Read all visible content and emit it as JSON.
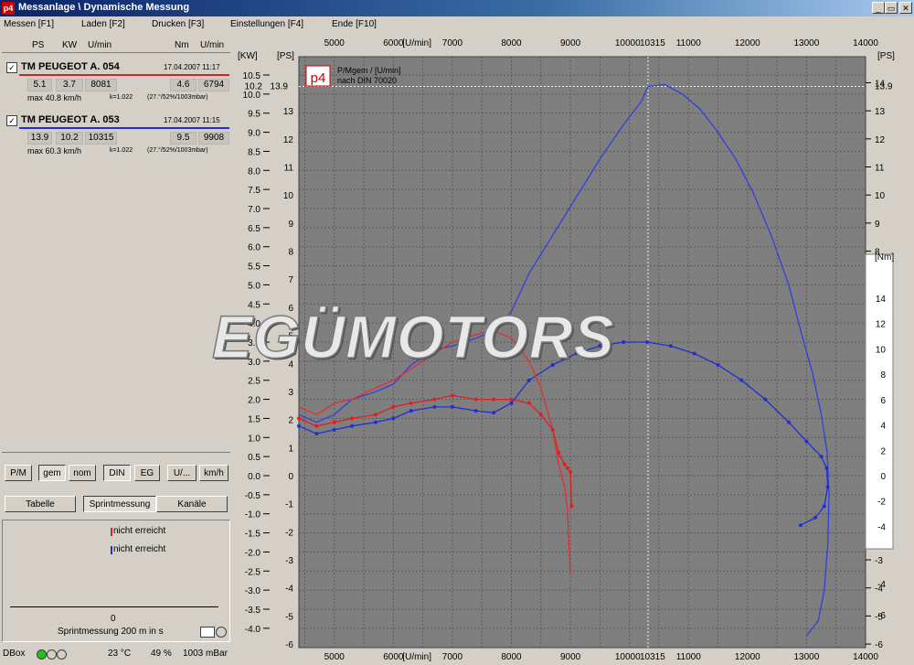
{
  "window": {
    "logo": "p4",
    "title": "Messanlage \\ Dynamische Messung",
    "min": "_",
    "max": "▭",
    "close": "✕"
  },
  "menu": [
    "Messen [F1]",
    "Laden [F2]",
    "Drucken [F3]",
    "Einstellungen [F4]",
    "Ende [F10]"
  ],
  "columns": [
    "PS",
    "KW",
    "U/min",
    "Nm",
    "U/min"
  ],
  "measurements": [
    {
      "checked": "✓",
      "name": "TM PEUGEOT A. 054",
      "date": "17.04.2007 11:17",
      "ps": "5.1",
      "kw": "3.7",
      "rpm": "8081",
      "nm": "4.6",
      "nm_rpm": "6794",
      "max": "max 40.8 km/h",
      "k": "k=1.022",
      "cond": "(27.°/52%/1003mbar)",
      "color": "#e02020"
    },
    {
      "checked": "✓",
      "name": "TM PEUGEOT A. 053",
      "date": "17.04.2007 11:15",
      "ps": "13.9",
      "kw": "10.2",
      "rpm": "10315",
      "nm": "9.5",
      "nm_rpm": "9908",
      "max": "max 60.3 km/h",
      "k": "k=1.022",
      "cond": "(27.°/52%/1003mbar)",
      "color": "#2030d0"
    }
  ],
  "buttons_row1": [
    "P/M",
    "gem",
    "nom",
    "DIN",
    "EG",
    "U/...",
    "km/h"
  ],
  "buttons_row2": [
    "Tabelle",
    "Sprintmessung",
    "Kanäle"
  ],
  "sprint": {
    "line1": "nicht erreicht",
    "line2": "nicht erreicht",
    "zero": "0",
    "label": "Sprintmessung 200 m in s"
  },
  "status": {
    "dbox": "DBox",
    "temp": "23 °C",
    "humidity": "49 %",
    "pressure": "1003 mBar"
  },
  "chart_data": {
    "type": "line",
    "legend_line1": "P/Mgem / [U/min]",
    "legend_line2": "nach DIN 70020",
    "legend_logo": "p4",
    "x_label": "[U/min]",
    "x_ticks": [
      "5000",
      "6000",
      "7000",
      "8000",
      "9000",
      "10000",
      "10315",
      "11000",
      "12000",
      "13000",
      "14000"
    ],
    "x_range": [
      4400,
      14000
    ],
    "kw_label": "[KW]",
    "ps_label": "[PS]",
    "nm_label": "[Nm]",
    "kw_ticks": [
      "10.5",
      "10.0",
      "9.5",
      "9.0",
      "8.5",
      "8.0",
      "7.5",
      "7.0",
      "6.5",
      "6.0",
      "5.5",
      "5.0",
      "4.5",
      "4.0",
      "3.5",
      "3.0",
      "2.5",
      "2.0",
      "1.5",
      "1.0",
      "0.5",
      "0.0",
      "-0.5",
      "-1.0",
      "-1.5",
      "-2.0",
      "-2.5",
      "-3.0",
      "-3.5",
      "-4.0"
    ],
    "ps_left_ticks": [
      "13",
      "12",
      "11",
      "10",
      "9",
      "8",
      "7",
      "6",
      "5",
      "4",
      "3",
      "2",
      "1",
      "0",
      "-1",
      "-2",
      "-3",
      "-4",
      "-5",
      "-6"
    ],
    "ps_right_ticks": [
      "14",
      "13",
      "12",
      "11",
      "10",
      "9",
      "8",
      "7",
      "6",
      "5",
      "4",
      "3",
      "2",
      "1",
      "0",
      "-1",
      "-2",
      "-3",
      "-4",
      "-5",
      "-6"
    ],
    "nm_ticks": [
      "14",
      "12",
      "10",
      "8",
      "6",
      "4",
      "2",
      "0",
      "-2",
      "-4"
    ],
    "nm_lower_ticks": [
      "-4",
      "-6"
    ],
    "peak_rpm": 10315,
    "peak_kw_label": "10.2",
    "peak_ps_left": "13.9",
    "peak_ps_right": "13.9",
    "series": [
      {
        "name": "TM PEUGEOT A. 053 Leistung",
        "color": "#3040e0",
        "marker": false,
        "points": [
          [
            4400,
            1.6
          ],
          [
            4700,
            1.4
          ],
          [
            5000,
            1.6
          ],
          [
            5300,
            2.0
          ],
          [
            5700,
            2.2
          ],
          [
            6000,
            2.4
          ],
          [
            6300,
            2.9
          ],
          [
            6700,
            3.3
          ],
          [
            7000,
            3.4
          ],
          [
            7400,
            3.6
          ],
          [
            7700,
            3.8
          ],
          [
            8000,
            4.3
          ],
          [
            8300,
            5.3
          ],
          [
            8700,
            6.3
          ],
          [
            9100,
            7.3
          ],
          [
            9500,
            8.3
          ],
          [
            9900,
            9.2
          ],
          [
            10200,
            9.8
          ],
          [
            10315,
            10.2
          ],
          [
            10600,
            10.25
          ],
          [
            10900,
            10.0
          ],
          [
            11200,
            9.6
          ],
          [
            11500,
            9.0
          ],
          [
            11800,
            8.3
          ],
          [
            12100,
            7.4
          ],
          [
            12400,
            6.3
          ],
          [
            12700,
            5.0
          ],
          [
            12900,
            3.8
          ],
          [
            13100,
            2.7
          ],
          [
            13250,
            1.6
          ],
          [
            13350,
            0.6
          ],
          [
            13380,
            -0.5
          ],
          [
            13360,
            -1.8
          ],
          [
            13300,
            -3.0
          ],
          [
            13200,
            -3.8
          ],
          [
            13000,
            -4.2
          ]
        ]
      },
      {
        "name": "TM PEUGEOT A. 053 Drehmoment",
        "color": "#2030d0",
        "marker": true,
        "points": [
          [
            4400,
            1.3
          ],
          [
            4700,
            1.1
          ],
          [
            5000,
            1.2
          ],
          [
            5300,
            1.3
          ],
          [
            5700,
            1.4
          ],
          [
            6000,
            1.5
          ],
          [
            6300,
            1.7
          ],
          [
            6700,
            1.8
          ],
          [
            7000,
            1.8
          ],
          [
            7400,
            1.7
          ],
          [
            7700,
            1.65
          ],
          [
            8000,
            1.9
          ],
          [
            8300,
            2.5
          ],
          [
            8700,
            2.9
          ],
          [
            9100,
            3.2
          ],
          [
            9500,
            3.4
          ],
          [
            9900,
            3.5
          ],
          [
            10300,
            3.5
          ],
          [
            10700,
            3.4
          ],
          [
            11100,
            3.2
          ],
          [
            11500,
            2.9
          ],
          [
            11900,
            2.5
          ],
          [
            12300,
            2.0
          ],
          [
            12700,
            1.4
          ],
          [
            13000,
            0.9
          ],
          [
            13250,
            0.5
          ],
          [
            13340,
            0.2
          ],
          [
            13360,
            -0.3
          ],
          [
            13300,
            -0.8
          ],
          [
            13150,
            -1.1
          ],
          [
            12900,
            -1.3
          ]
        ]
      },
      {
        "name": "TM PEUGEOT A. 054 Leistung",
        "color": "#e03030",
        "marker": false,
        "points": [
          [
            4400,
            1.8
          ],
          [
            4700,
            1.6
          ],
          [
            5000,
            1.9
          ],
          [
            5300,
            2.0
          ],
          [
            5700,
            2.3
          ],
          [
            6000,
            2.5
          ],
          [
            6300,
            2.8
          ],
          [
            6700,
            3.2
          ],
          [
            7000,
            3.5
          ],
          [
            7400,
            3.7
          ],
          [
            7700,
            3.8
          ],
          [
            8000,
            3.6
          ],
          [
            8300,
            3.0
          ],
          [
            8500,
            2.3
          ],
          [
            8700,
            1.2
          ],
          [
            8800,
            0.3
          ],
          [
            8900,
            -0.3
          ],
          [
            8950,
            -0.9
          ],
          [
            8980,
            -2.0
          ],
          [
            9000,
            -2.6
          ]
        ]
      },
      {
        "name": "TM PEUGEOT A. 054 Drehmoment",
        "color": "#e02020",
        "marker": true,
        "points": [
          [
            4400,
            1.5
          ],
          [
            4700,
            1.3
          ],
          [
            5000,
            1.4
          ],
          [
            5300,
            1.5
          ],
          [
            5700,
            1.6
          ],
          [
            6000,
            1.8
          ],
          [
            6300,
            1.9
          ],
          [
            6700,
            2.0
          ],
          [
            7000,
            2.1
          ],
          [
            7400,
            2.0
          ],
          [
            7700,
            2.0
          ],
          [
            8000,
            2.0
          ],
          [
            8300,
            1.9
          ],
          [
            8500,
            1.6
          ],
          [
            8700,
            1.2
          ],
          [
            8800,
            0.6
          ],
          [
            8900,
            0.3
          ],
          [
            8950,
            0.2
          ],
          [
            9000,
            0.1
          ],
          [
            9020,
            -0.8
          ]
        ]
      }
    ]
  },
  "watermark": "EGÜMOTORS"
}
